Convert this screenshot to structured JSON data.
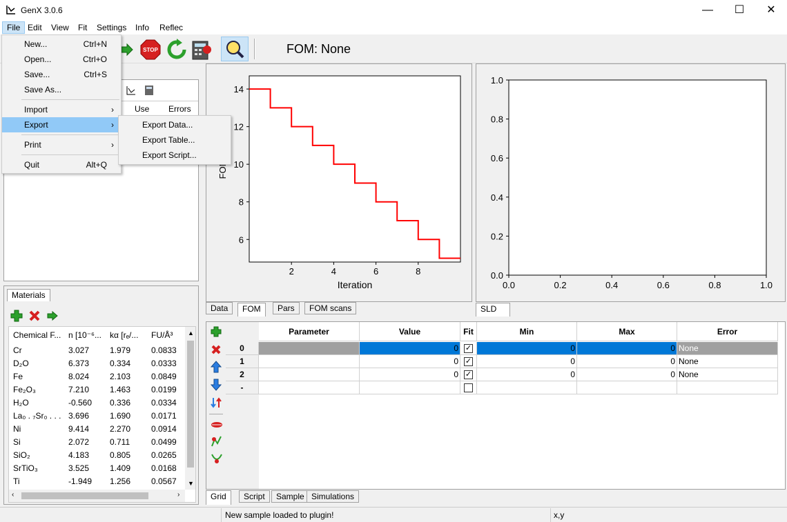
{
  "window": {
    "title": "GenX 3.0.6",
    "minimize": "—",
    "maximize": "☐",
    "close": "✕"
  },
  "menubar": [
    "File",
    "Edit",
    "View",
    "Fit",
    "Settings",
    "Info",
    "Reflec"
  ],
  "fom_label": "FOM: None",
  "file_menu": {
    "items": [
      {
        "label": "New...",
        "shortcut": "Ctrl+N"
      },
      {
        "label": "Open...",
        "shortcut": "Ctrl+O"
      },
      {
        "label": "Save...",
        "shortcut": "Ctrl+S"
      },
      {
        "label": "Save As...",
        "shortcut": ""
      },
      {
        "label": "Import",
        "arrow": "›"
      },
      {
        "label": "Export",
        "arrow": "›"
      },
      {
        "label": "Print",
        "arrow": "›"
      },
      {
        "label": "Quit",
        "shortcut": "Alt+Q"
      }
    ]
  },
  "export_submenu": [
    "Export Data...",
    "Export Table...",
    "Export Script..."
  ],
  "data_panel": {
    "col_use": "Use",
    "col_errors": "Errors"
  },
  "materials": {
    "tab": "Materials",
    "headers": [
      "Chemical F...",
      "n [10⁻⁶...",
      "kα [rₑ/...",
      "FU/Å³"
    ],
    "rows": [
      [
        "Cr",
        "3.027",
        "1.979",
        "0.0833"
      ],
      [
        "D₂O",
        "6.373",
        "0.334",
        "0.0333"
      ],
      [
        "Fe",
        "8.024",
        "2.103",
        "0.0849"
      ],
      [
        "Fe₂O₃",
        "7.210",
        "1.463",
        "0.0199"
      ],
      [
        "H₂O",
        "-0.560",
        "0.336",
        "0.0334"
      ],
      [
        "La₀ . ₇Sr₀ . . .",
        "3.696",
        "1.690",
        "0.0171"
      ],
      [
        "Ni",
        "9.414",
        "2.270",
        "0.0914"
      ],
      [
        "Si",
        "2.072",
        "0.711",
        "0.0499"
      ],
      [
        "SiO₂",
        "4.183",
        "0.805",
        "0.0265"
      ],
      [
        "SrTiO₃",
        "3.525",
        "1.409",
        "0.0168"
      ],
      [
        "Ti",
        "-1.949",
        "1.256",
        "0.0567"
      ]
    ]
  },
  "plot_tabs": [
    "Data",
    "FOM",
    "Pars",
    "FOM scans"
  ],
  "sld_tab": "SLD",
  "chart_data": [
    {
      "type": "line",
      "xlabel": "Iteration",
      "ylabel": "FOM",
      "x": [
        0,
        1,
        2,
        3,
        4,
        5,
        6,
        7,
        8,
        9,
        10
      ],
      "y": [
        14,
        13,
        12,
        11,
        10,
        9,
        8,
        7,
        6,
        5,
        5
      ],
      "step": "post",
      "color": "#ff0000",
      "xlim": [
        0,
        10
      ],
      "ylim": [
        4.8,
        14.7
      ],
      "xticks": [
        "2",
        "4",
        "6",
        "8"
      ],
      "yticks": [
        "6",
        "8",
        "10",
        "12",
        "14"
      ]
    },
    {
      "type": "line",
      "xlim": [
        0,
        1
      ],
      "ylim": [
        0,
        1
      ],
      "xticks": [
        "0.0",
        "0.2",
        "0.4",
        "0.6",
        "0.8",
        "1.0"
      ],
      "yticks": [
        "0.0",
        "0.2",
        "0.4",
        "0.6",
        "0.8",
        "1.0"
      ]
    }
  ],
  "grid": {
    "headers": [
      "Parameter",
      "Value",
      "Fit",
      "Min",
      "Max",
      "Error"
    ],
    "rows": [
      {
        "id": "0",
        "param": "",
        "value": "0",
        "fit": true,
        "min": "0",
        "max": "0",
        "error": "None"
      },
      {
        "id": "1",
        "param": "",
        "value": "0",
        "fit": true,
        "min": "0",
        "max": "0",
        "error": "None"
      },
      {
        "id": "2",
        "param": "",
        "value": "0",
        "fit": true,
        "min": "0",
        "max": "0",
        "error": "None"
      },
      {
        "id": "-",
        "param": "",
        "value": "",
        "fit": false,
        "min": "",
        "max": "",
        "error": ""
      }
    ]
  },
  "bottom_tabs": [
    "Grid",
    "Script",
    "Sample",
    "Simulations"
  ],
  "status": {
    "message": "New sample loaded to plugin!",
    "coords": "x,y"
  },
  "colors": {
    "selection": "#0078d7",
    "menu_highlight": "#91c9f7",
    "fom_line": "#ff0000"
  }
}
